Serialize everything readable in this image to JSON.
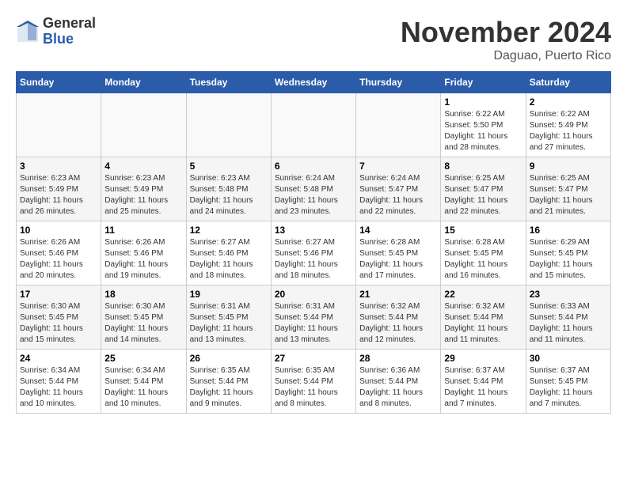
{
  "logo": {
    "general": "General",
    "blue": "Blue"
  },
  "title": "November 2024",
  "location": "Daguao, Puerto Rico",
  "days_header": [
    "Sunday",
    "Monday",
    "Tuesday",
    "Wednesday",
    "Thursday",
    "Friday",
    "Saturday"
  ],
  "weeks": [
    [
      {
        "day": "",
        "info": ""
      },
      {
        "day": "",
        "info": ""
      },
      {
        "day": "",
        "info": ""
      },
      {
        "day": "",
        "info": ""
      },
      {
        "day": "",
        "info": ""
      },
      {
        "day": "1",
        "info": "Sunrise: 6:22 AM\nSunset: 5:50 PM\nDaylight: 11 hours and 28 minutes."
      },
      {
        "day": "2",
        "info": "Sunrise: 6:22 AM\nSunset: 5:49 PM\nDaylight: 11 hours and 27 minutes."
      }
    ],
    [
      {
        "day": "3",
        "info": "Sunrise: 6:23 AM\nSunset: 5:49 PM\nDaylight: 11 hours and 26 minutes."
      },
      {
        "day": "4",
        "info": "Sunrise: 6:23 AM\nSunset: 5:49 PM\nDaylight: 11 hours and 25 minutes."
      },
      {
        "day": "5",
        "info": "Sunrise: 6:23 AM\nSunset: 5:48 PM\nDaylight: 11 hours and 24 minutes."
      },
      {
        "day": "6",
        "info": "Sunrise: 6:24 AM\nSunset: 5:48 PM\nDaylight: 11 hours and 23 minutes."
      },
      {
        "day": "7",
        "info": "Sunrise: 6:24 AM\nSunset: 5:47 PM\nDaylight: 11 hours and 22 minutes."
      },
      {
        "day": "8",
        "info": "Sunrise: 6:25 AM\nSunset: 5:47 PM\nDaylight: 11 hours and 22 minutes."
      },
      {
        "day": "9",
        "info": "Sunrise: 6:25 AM\nSunset: 5:47 PM\nDaylight: 11 hours and 21 minutes."
      }
    ],
    [
      {
        "day": "10",
        "info": "Sunrise: 6:26 AM\nSunset: 5:46 PM\nDaylight: 11 hours and 20 minutes."
      },
      {
        "day": "11",
        "info": "Sunrise: 6:26 AM\nSunset: 5:46 PM\nDaylight: 11 hours and 19 minutes."
      },
      {
        "day": "12",
        "info": "Sunrise: 6:27 AM\nSunset: 5:46 PM\nDaylight: 11 hours and 18 minutes."
      },
      {
        "day": "13",
        "info": "Sunrise: 6:27 AM\nSunset: 5:46 PM\nDaylight: 11 hours and 18 minutes."
      },
      {
        "day": "14",
        "info": "Sunrise: 6:28 AM\nSunset: 5:45 PM\nDaylight: 11 hours and 17 minutes."
      },
      {
        "day": "15",
        "info": "Sunrise: 6:28 AM\nSunset: 5:45 PM\nDaylight: 11 hours and 16 minutes."
      },
      {
        "day": "16",
        "info": "Sunrise: 6:29 AM\nSunset: 5:45 PM\nDaylight: 11 hours and 15 minutes."
      }
    ],
    [
      {
        "day": "17",
        "info": "Sunrise: 6:30 AM\nSunset: 5:45 PM\nDaylight: 11 hours and 15 minutes."
      },
      {
        "day": "18",
        "info": "Sunrise: 6:30 AM\nSunset: 5:45 PM\nDaylight: 11 hours and 14 minutes."
      },
      {
        "day": "19",
        "info": "Sunrise: 6:31 AM\nSunset: 5:45 PM\nDaylight: 11 hours and 13 minutes."
      },
      {
        "day": "20",
        "info": "Sunrise: 6:31 AM\nSunset: 5:44 PM\nDaylight: 11 hours and 13 minutes."
      },
      {
        "day": "21",
        "info": "Sunrise: 6:32 AM\nSunset: 5:44 PM\nDaylight: 11 hours and 12 minutes."
      },
      {
        "day": "22",
        "info": "Sunrise: 6:32 AM\nSunset: 5:44 PM\nDaylight: 11 hours and 11 minutes."
      },
      {
        "day": "23",
        "info": "Sunrise: 6:33 AM\nSunset: 5:44 PM\nDaylight: 11 hours and 11 minutes."
      }
    ],
    [
      {
        "day": "24",
        "info": "Sunrise: 6:34 AM\nSunset: 5:44 PM\nDaylight: 11 hours and 10 minutes."
      },
      {
        "day": "25",
        "info": "Sunrise: 6:34 AM\nSunset: 5:44 PM\nDaylight: 11 hours and 10 minutes."
      },
      {
        "day": "26",
        "info": "Sunrise: 6:35 AM\nSunset: 5:44 PM\nDaylight: 11 hours and 9 minutes."
      },
      {
        "day": "27",
        "info": "Sunrise: 6:35 AM\nSunset: 5:44 PM\nDaylight: 11 hours and 8 minutes."
      },
      {
        "day": "28",
        "info": "Sunrise: 6:36 AM\nSunset: 5:44 PM\nDaylight: 11 hours and 8 minutes."
      },
      {
        "day": "29",
        "info": "Sunrise: 6:37 AM\nSunset: 5:44 PM\nDaylight: 11 hours and 7 minutes."
      },
      {
        "day": "30",
        "info": "Sunrise: 6:37 AM\nSunset: 5:45 PM\nDaylight: 11 hours and 7 minutes."
      }
    ]
  ]
}
